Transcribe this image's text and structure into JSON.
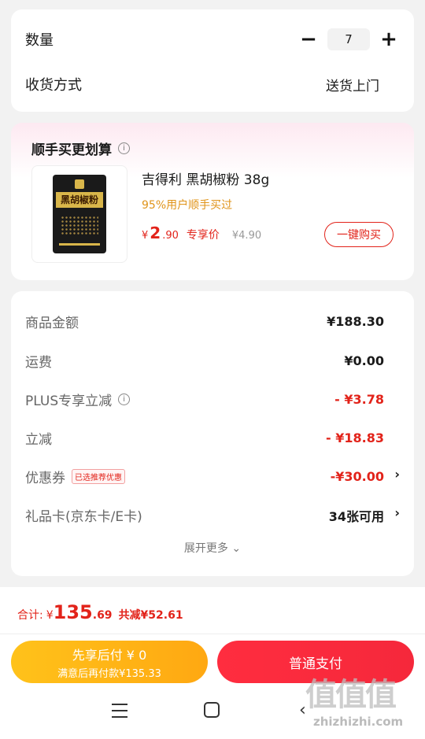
{
  "order": {
    "qty_label": "数量",
    "qty_value": "7",
    "minus": "−",
    "plus": "+",
    "ship_label": "收货方式",
    "ship_value": "送货上门"
  },
  "addon": {
    "title": "顺手买更划算",
    "info_icon": "i",
    "product_name": "吉得利 黑胡椒粉 38g",
    "product_sub": "95%用户顺手买过",
    "package_text": "黑胡椒粉",
    "price_currency": "¥",
    "price_int": "2",
    "price_dec": ".90",
    "price_tag": "专享价",
    "orig_price": "¥4.90",
    "buy_label": "一键购买"
  },
  "summary": {
    "rows": [
      {
        "label": "商品金额",
        "value": "¥188.30"
      },
      {
        "label": "运费",
        "value": "¥0.00"
      },
      {
        "label": "PLUS专享立减",
        "value": "- ¥3.78"
      },
      {
        "label": "立减",
        "value": "- ¥18.83"
      },
      {
        "label": "优惠券",
        "badge": "已选推荐优惠",
        "value": "-¥30.00"
      },
      {
        "label": "礼品卡(京东卡/E卡)",
        "value": "34张可用"
      }
    ],
    "expand_label": "展开更多",
    "expand_icon": "⌄",
    "chevron": "›"
  },
  "footer": {
    "total_label": "合计:",
    "total_currency": "¥",
    "total_int": "135",
    "total_dec": ".69",
    "saved": "共减¥52.61",
    "pay_later_title": "先享后付 ¥ 0",
    "pay_later_sub": "满意后再付款¥135.33",
    "pay_normal": "普通支付"
  },
  "watermark": {
    "big": "值值值",
    "small": "zhizhizhi.com"
  },
  "nav": {
    "back": "‹"
  },
  "colors": {
    "accent": "#e2231a",
    "pay_later": "#ffb515",
    "pay_normal": "#f7293d"
  }
}
